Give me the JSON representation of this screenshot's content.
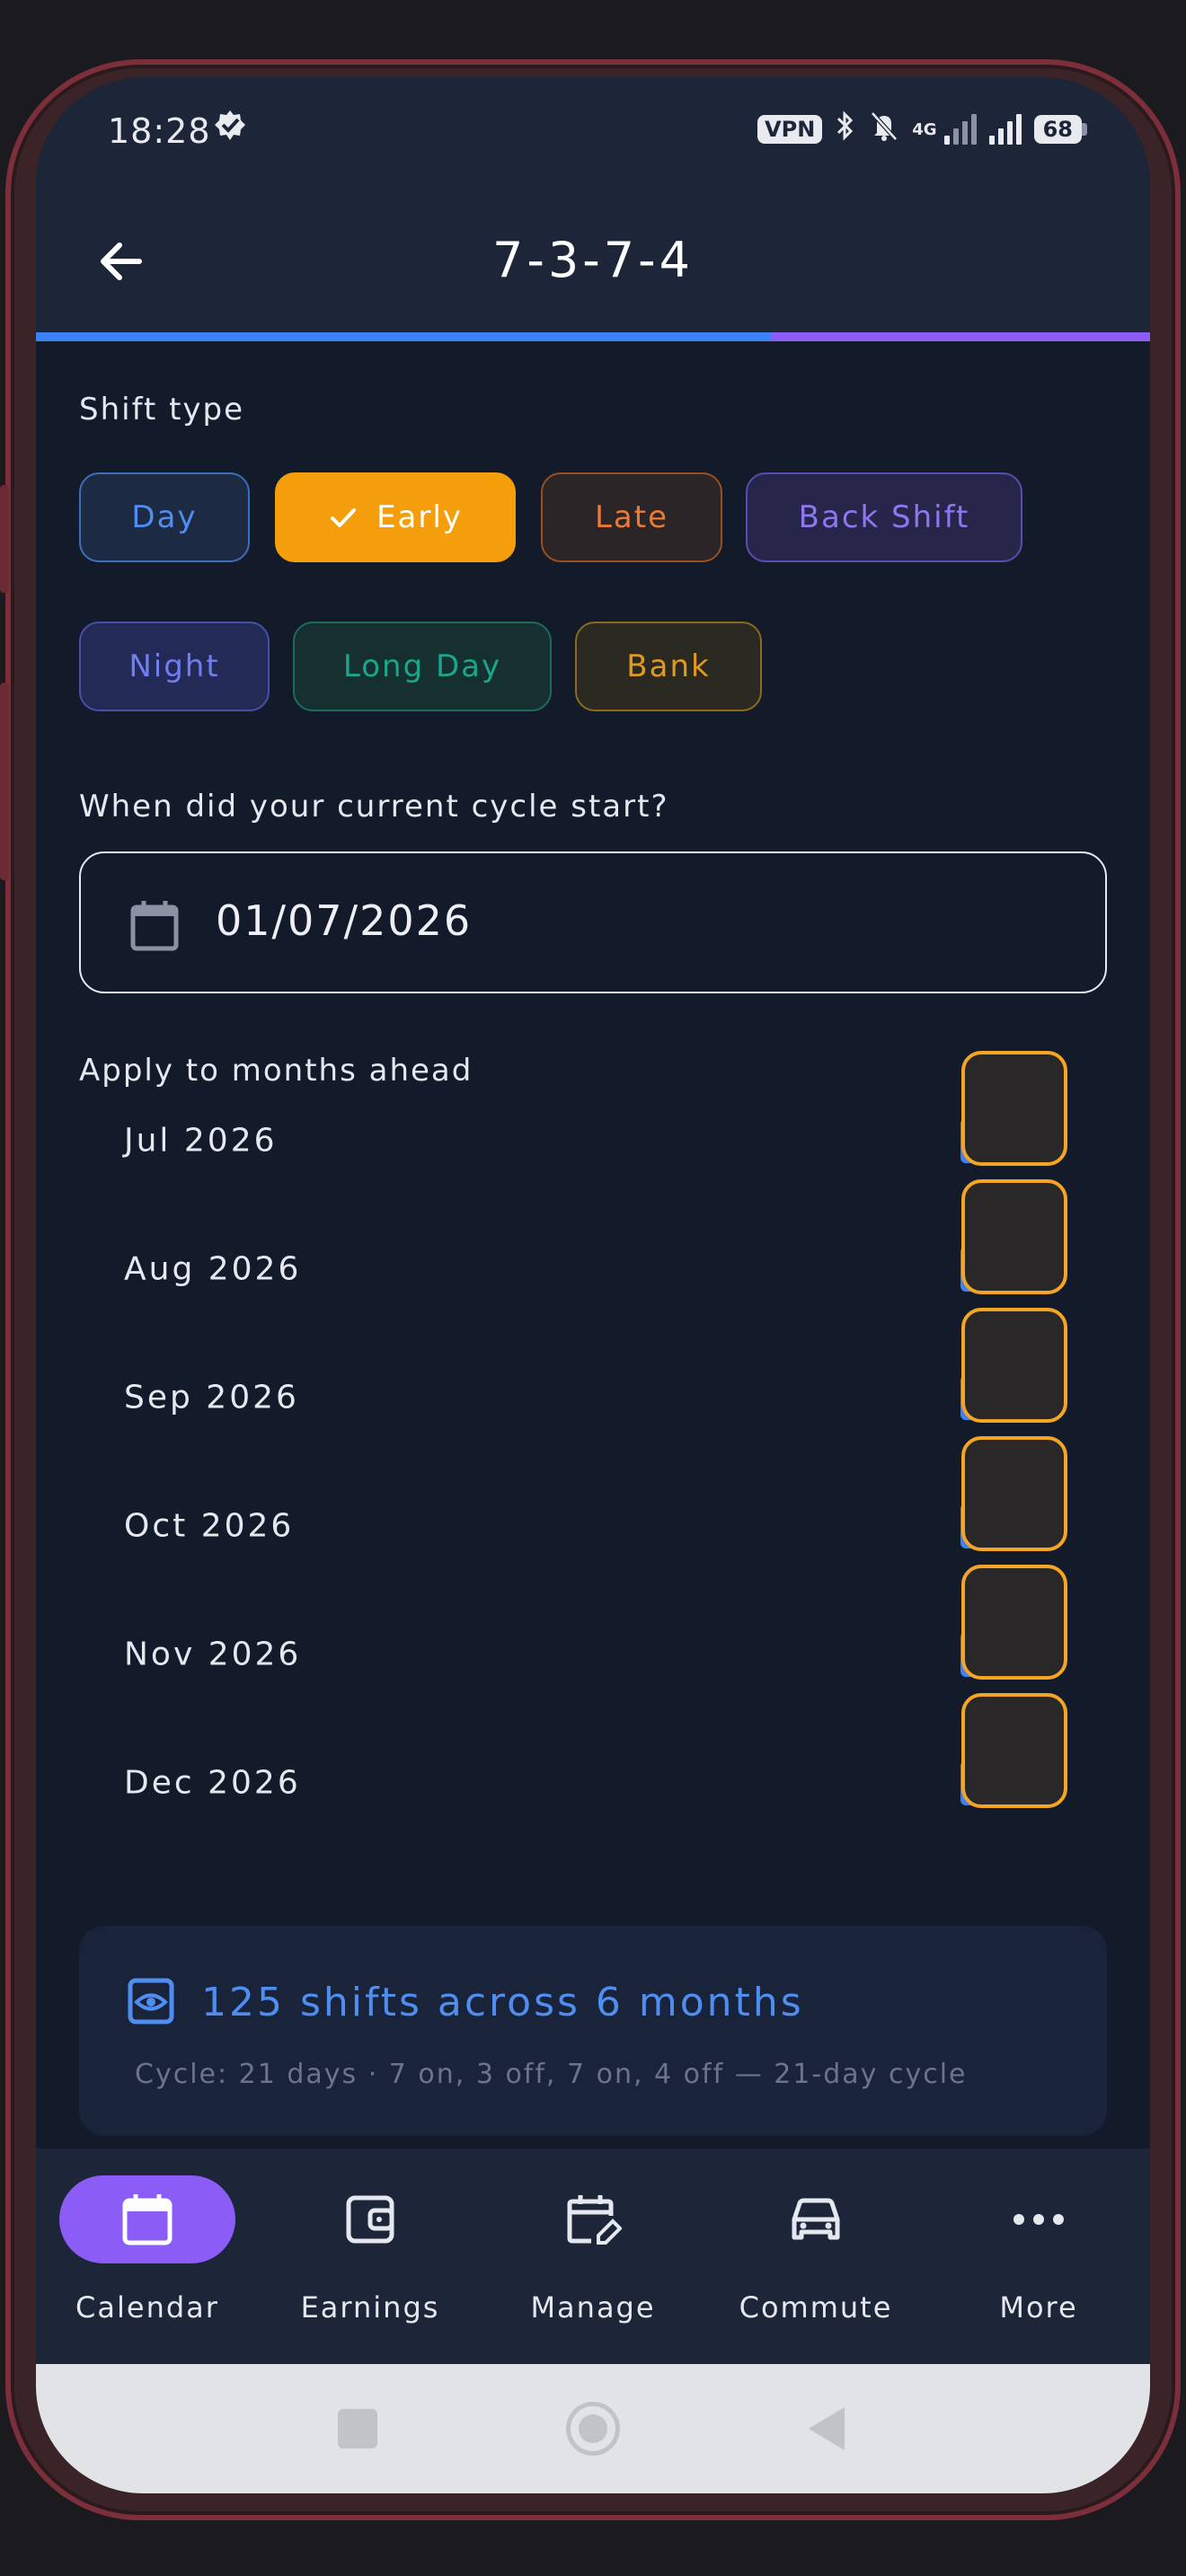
{
  "status_bar": {
    "time": "18:28",
    "vpn": "VPN",
    "network": "4G",
    "battery": "68"
  },
  "app_bar": {
    "title": "7-3-7-4"
  },
  "shift_type": {
    "label": "Shift type",
    "selected": "Early",
    "options": [
      "Day",
      "Early",
      "Late",
      "Back Shift",
      "Night",
      "Long Day",
      "Bank"
    ]
  },
  "cycle_start": {
    "label": "When did your current cycle start?",
    "value": "01/07/2026"
  },
  "months": {
    "label": "Apply to months ahead",
    "items": [
      {
        "label": "Jul 2026",
        "checked": true
      },
      {
        "label": "Aug 2026",
        "checked": true
      },
      {
        "label": "Sep 2026",
        "checked": true
      },
      {
        "label": "Oct 2026",
        "checked": true
      },
      {
        "label": "Nov 2026",
        "checked": true
      },
      {
        "label": "Dec 2026",
        "checked": true
      }
    ]
  },
  "summary": {
    "title": "125 shifts across 6 months",
    "subtitle": "Cycle: 21 days · 7 on, 3 off, 7 on, 4 off — 21-day cycle"
  },
  "bottom_nav": {
    "active": "Calendar",
    "items": [
      {
        "label": "Calendar",
        "icon": "calendar-icon"
      },
      {
        "label": "Earnings",
        "icon": "wallet-icon"
      },
      {
        "label": "Manage",
        "icon": "calendar-edit-icon"
      },
      {
        "label": "Commute",
        "icon": "car-icon"
      },
      {
        "label": "More",
        "icon": "more-icon"
      }
    ]
  },
  "colors": {
    "accent_blue": "#3b82f6",
    "accent_purple": "#8b5cf6",
    "accent_orange": "#f59e0b",
    "background": "#131a29"
  }
}
